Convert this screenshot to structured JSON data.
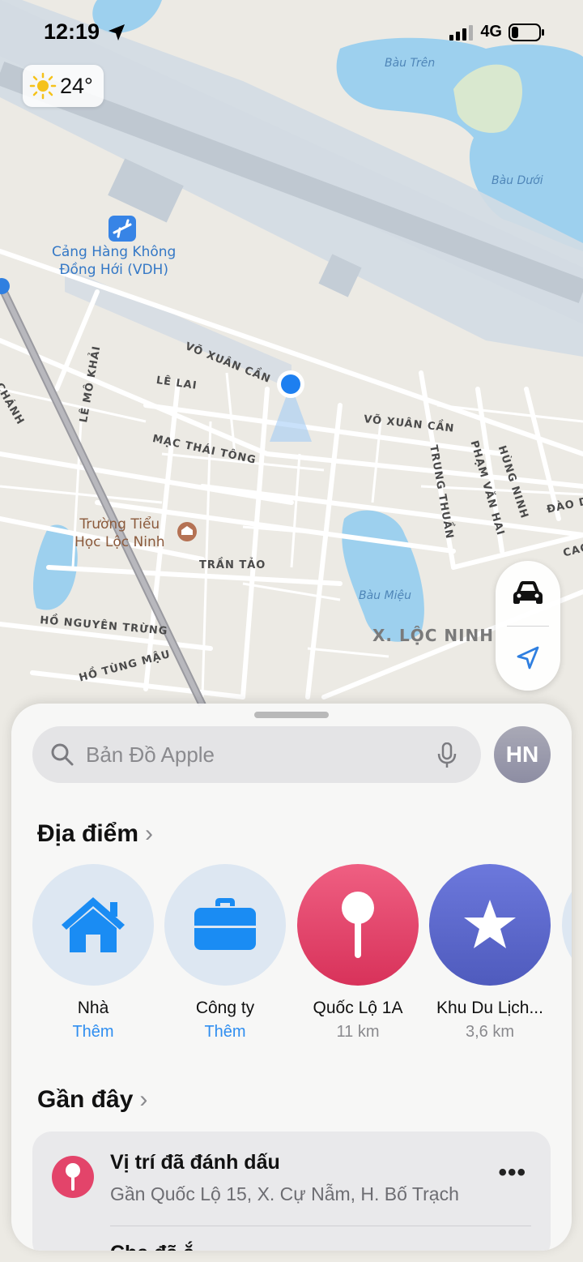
{
  "status_bar": {
    "time": "12:19",
    "network": "4G"
  },
  "weather": {
    "temperature": "24°"
  },
  "map": {
    "labels": {
      "airport": "Cảng Hàng Không\nĐồng Hới (VDH)",
      "school": "Trường Tiểu\nHọc Lộc Ninh",
      "bau_tren": "Bàu Trên",
      "bau_duoi": "Bàu Dưới",
      "bau_mieu": "Bàu Miệu",
      "ward": "X. LỘC NINH",
      "vo_xuan_can_1": "VÕ XUÂN CẦN",
      "vo_xuan_can_2": "VÕ XUÂN CẦN",
      "le_lai": "LÊ LAI",
      "mac_thai_tong": "MẠC THÁI TÔNG",
      "tran_tao": "TRẦN TẢO",
      "ho_nguyen_trung": "HỒ NGUYÊN TRỪNG",
      "ho_tung_mau": "HỒ TÙNG MẬU",
      "le_mo_khai": "LÊ MÔ KHẢI",
      "chanh": "CHÁNH",
      "trung_thuan": "TRUNG THUẦN",
      "pham_van_hai": "PHẠM VĂN HAI",
      "hung_ninh": "HÙNG NINH",
      "dao_d": "ĐÀO D",
      "cao": "CAO"
    }
  },
  "search": {
    "placeholder": "Bản Đồ Apple"
  },
  "avatar": {
    "initials": "HN"
  },
  "places": {
    "title": "Địa điểm",
    "items": [
      {
        "name": "Nhà",
        "sub": "Thêm",
        "icon": "house-icon",
        "color": "#dde7f2"
      },
      {
        "name": "Công ty",
        "sub": "Thêm",
        "icon": "briefcase-icon",
        "color": "#dde7f2"
      },
      {
        "name": "Quốc Lộ 1A",
        "sub": "11 km",
        "icon": "pin-icon",
        "color": "#e23f66"
      },
      {
        "name": "Khu Du Lịch...",
        "sub": "3,6 km",
        "icon": "star-icon",
        "color": "#5a66c9"
      }
    ]
  },
  "recents": {
    "title": "Gần đây",
    "items": [
      {
        "title": "Vị trí đã đánh dấu",
        "subtitle": "Gần Quốc Lộ 15, X. Cự Nẫm, H. Bố Trạch",
        "more": "•••"
      },
      {
        "title": "Cha  đã  ắ  "
      }
    ]
  },
  "colors": {
    "accent": "#2f8ef0",
    "pin": "#e23f66",
    "star": "#5a66c9",
    "location": "#1d7ff0"
  }
}
